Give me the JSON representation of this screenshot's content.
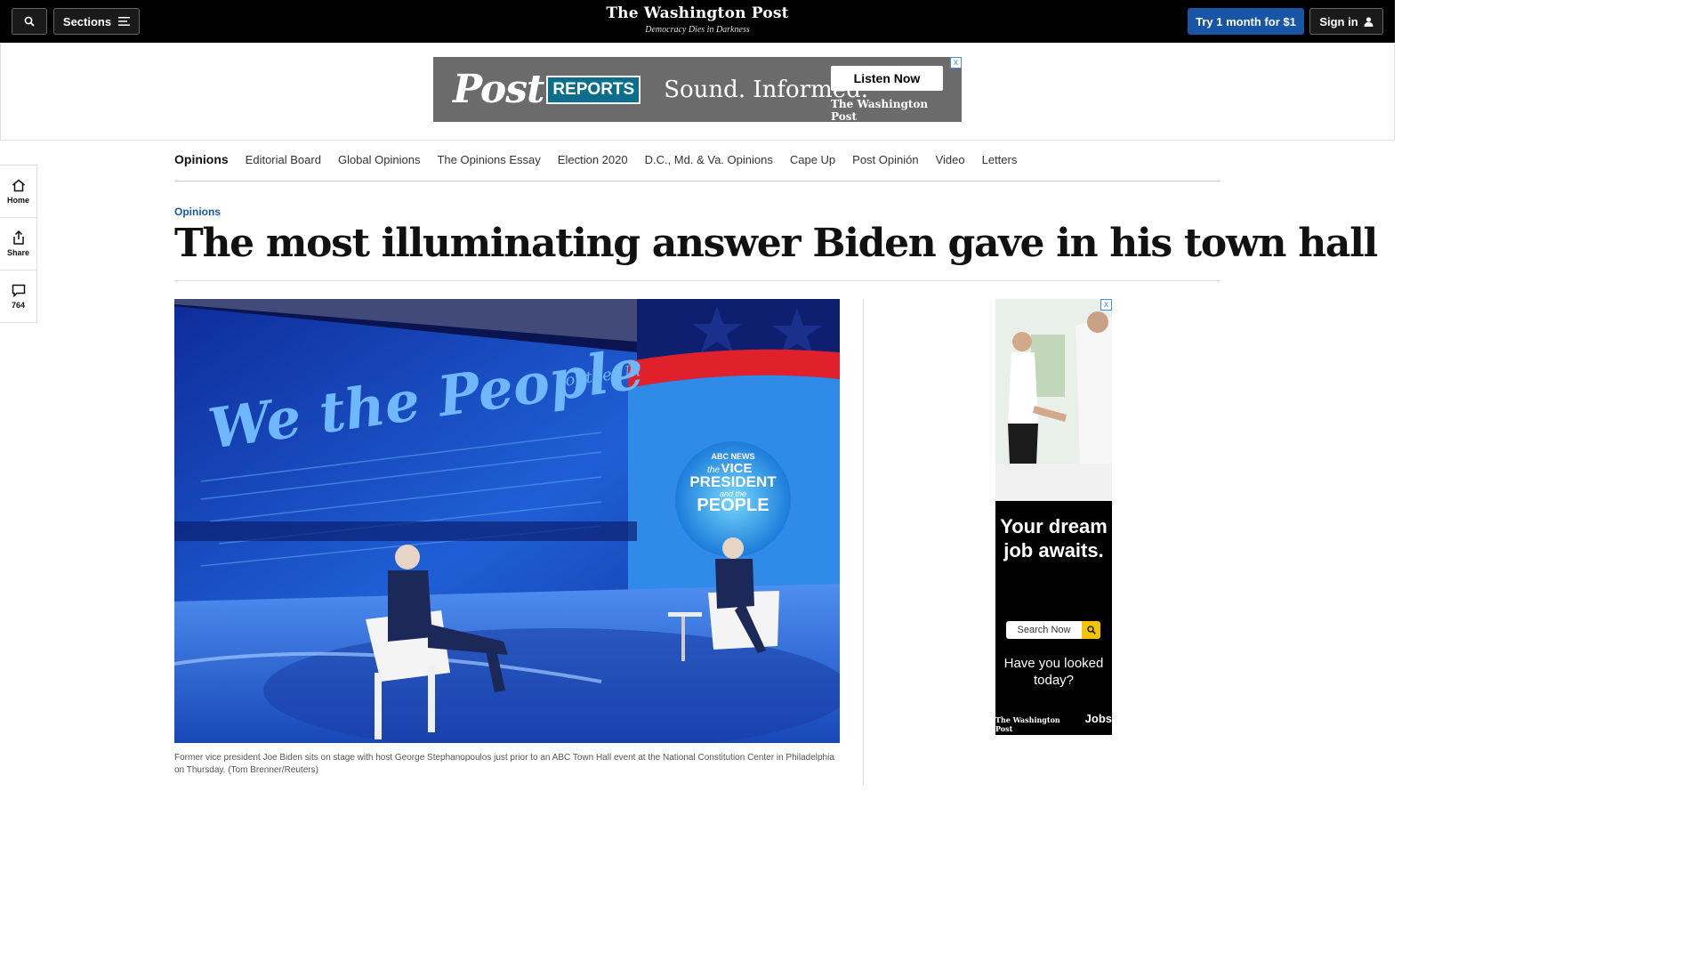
{
  "header": {
    "search_icon": "search-icon",
    "sections_label": "Sections",
    "logo": "The Washington Post",
    "tagline": "Democracy Dies in Darkness",
    "subscribe_label": "Try 1 month for $1",
    "signin_label": "Sign in"
  },
  "top_ad": {
    "brand": "Post",
    "brand_badge": "REPORTS",
    "tagline": "Sound. Informed.",
    "cta": "Listen Now",
    "publisher": "The Washington Post",
    "adchoices": "x"
  },
  "side_rail": {
    "home_label": "Home",
    "share_label": "Share",
    "comments_count": "764"
  },
  "section_nav": {
    "title": "Opinions",
    "items": [
      "Editorial Board",
      "Global Opinions",
      "The Opinions Essay",
      "Election 2020",
      "D.C., Md. & Va. Opinions",
      "Cape Up",
      "Post Opinión",
      "Video",
      "Letters"
    ]
  },
  "article": {
    "kicker": "Opinions",
    "headline": "The most illuminating answer Biden gave in his town hall",
    "image_text_we_the_people": "We the People",
    "image_text_of_the": "of the Un",
    "image_logo_news": "ABC NEWS",
    "image_logo_the": "the",
    "image_logo_vp": "VICE",
    "image_logo_president": "PRESIDENT",
    "image_logo_and": "and the",
    "image_logo_people": "PEOPLE",
    "caption": "Former vice president Joe Biden sits on stage with host George Stephanopoulos just prior to an ABC Town Hall event at the National Constitution Center in Philadelphia on Thursday. (Tom Brenner/Reuters)"
  },
  "side_ad": {
    "headline": "Your dream job awaits.",
    "search_placeholder": "Search Now",
    "question": "Have you looked today?",
    "publisher": "The Washington Post",
    "product": "Jobs",
    "adchoices": "x"
  },
  "colors": {
    "accent": "#1955a5",
    "topbar": "#000000"
  }
}
